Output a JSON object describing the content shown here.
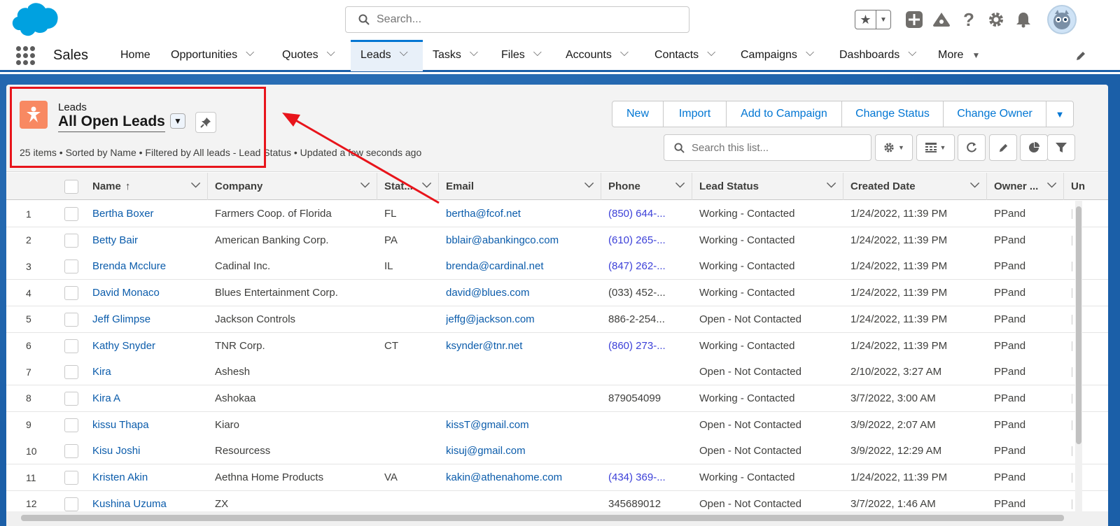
{
  "header": {
    "search_placeholder": "Search...",
    "icons": [
      "star-icon",
      "plus-icon",
      "trailhead-icon",
      "help-icon",
      "gear-icon",
      "bell-icon"
    ]
  },
  "nav": {
    "app_name": "Sales",
    "tabs": [
      {
        "label": "Home",
        "chevron": false
      },
      {
        "label": "Opportunities",
        "chevron": true
      },
      {
        "label": "Quotes",
        "chevron": true
      },
      {
        "label": "Leads",
        "chevron": true,
        "active": true
      },
      {
        "label": "Tasks",
        "chevron": true
      },
      {
        "label": "Files",
        "chevron": true
      },
      {
        "label": "Accounts",
        "chevron": true
      },
      {
        "label": "Contacts",
        "chevron": true
      },
      {
        "label": "Campaigns",
        "chevron": true
      },
      {
        "label": "Dashboards",
        "chevron": true
      },
      {
        "label": "More",
        "chevron": true
      }
    ]
  },
  "list": {
    "object_label": "Leads",
    "title": "All Open Leads",
    "meta": "25 items • Sorted by Name • Filtered by All leads - Lead Status • Updated a few seconds ago",
    "actions": [
      "New",
      "Import",
      "Add to Campaign",
      "Change Status",
      "Change Owner"
    ],
    "search_placeholder": "Search this list..."
  },
  "table": {
    "columns": [
      "Name",
      "Company",
      "Stat...",
      "Email",
      "Phone",
      "Lead Status",
      "Created Date",
      "Owner ...",
      "Un"
    ],
    "sort_indicator": "↑",
    "rows": [
      {
        "num": "1",
        "name": "Bertha Boxer",
        "company": "Farmers Coop. of Florida",
        "state": "FL",
        "email": "bertha@fcof.net",
        "phone": "(850) 644-...",
        "phone_link": true,
        "status": "Working - Contacted",
        "created": "1/24/2022, 11:39 PM",
        "owner": "PPand"
      },
      {
        "num": "2",
        "name": "Betty Bair",
        "company": "American Banking Corp.",
        "state": "PA",
        "email": "bblair@abankingco.com",
        "phone": "(610) 265-...",
        "phone_link": true,
        "status": "Working - Contacted",
        "created": "1/24/2022, 11:39 PM",
        "owner": "PPand"
      },
      {
        "num": "3",
        "name": "Brenda Mcclure",
        "company": "Cadinal Inc.",
        "state": "IL",
        "email": "brenda@cardinal.net",
        "phone": "(847) 262-...",
        "phone_link": true,
        "status": "Working - Contacted",
        "created": "1/24/2022, 11:39 PM",
        "owner": "PPand"
      },
      {
        "num": "4",
        "name": "David Monaco",
        "company": "Blues Entertainment Corp.",
        "state": "",
        "email": "david@blues.com",
        "phone": "(033) 452-...",
        "phone_link": false,
        "status": "Working - Contacted",
        "created": "1/24/2022, 11:39 PM",
        "owner": "PPand"
      },
      {
        "num": "5",
        "name": "Jeff Glimpse",
        "company": "Jackson Controls",
        "state": "",
        "email": "jeffg@jackson.com",
        "phone": "886-2-254...",
        "phone_link": false,
        "status": "Open - Not Contacted",
        "created": "1/24/2022, 11:39 PM",
        "owner": "PPand"
      },
      {
        "num": "6",
        "name": "Kathy Snyder",
        "company": "TNR Corp.",
        "state": "CT",
        "email": "ksynder@tnr.net",
        "phone": "(860) 273-...",
        "phone_link": true,
        "status": "Working - Contacted",
        "created": "1/24/2022, 11:39 PM",
        "owner": "PPand"
      },
      {
        "num": "7",
        "name": "Kira",
        "company": "Ashesh",
        "state": "",
        "email": "",
        "phone": "",
        "phone_link": false,
        "status": "Open - Not Contacted",
        "created": "2/10/2022, 3:27 AM",
        "owner": "PPand"
      },
      {
        "num": "8",
        "name": "Kira A",
        "company": "Ashokaa",
        "state": "",
        "email": "",
        "phone": "879054099",
        "phone_link": false,
        "status": "Working - Contacted",
        "created": "3/7/2022, 3:00 AM",
        "owner": "PPand"
      },
      {
        "num": "9",
        "name": "kissu Thapa",
        "company": "Kiaro",
        "state": "",
        "email": "kissT@gmail.com",
        "phone": "",
        "phone_link": false,
        "status": "Open - Not Contacted",
        "created": "3/9/2022, 2:07 AM",
        "owner": "PPand"
      },
      {
        "num": "10",
        "name": "Kisu Joshi",
        "company": "Resourcess",
        "state": "",
        "email": "kisuj@gmail.com",
        "phone": "",
        "phone_link": false,
        "status": "Open - Not Contacted",
        "created": "3/9/2022, 12:29 AM",
        "owner": "PPand"
      },
      {
        "num": "11",
        "name": "Kristen Akin",
        "company": "Aethna Home Products",
        "state": "VA",
        "email": "kakin@athenahome.com",
        "phone": "(434) 369-...",
        "phone_link": true,
        "status": "Working - Contacted",
        "created": "1/24/2022, 11:39 PM",
        "owner": "PPand"
      },
      {
        "num": "12",
        "name": "Kushina Uzuma",
        "company": "ZX",
        "state": "",
        "email": "",
        "phone": "345689012",
        "phone_link": false,
        "status": "Open - Not Contacted",
        "created": "3/7/2022, 1:46 AM",
        "owner": "PPand"
      }
    ]
  },
  "colors": {
    "brand_blue": "#0176d3",
    "backdrop_blue": "#1b5fa8",
    "lead_icon": "#f88962",
    "annotation_red": "#e8141b"
  }
}
